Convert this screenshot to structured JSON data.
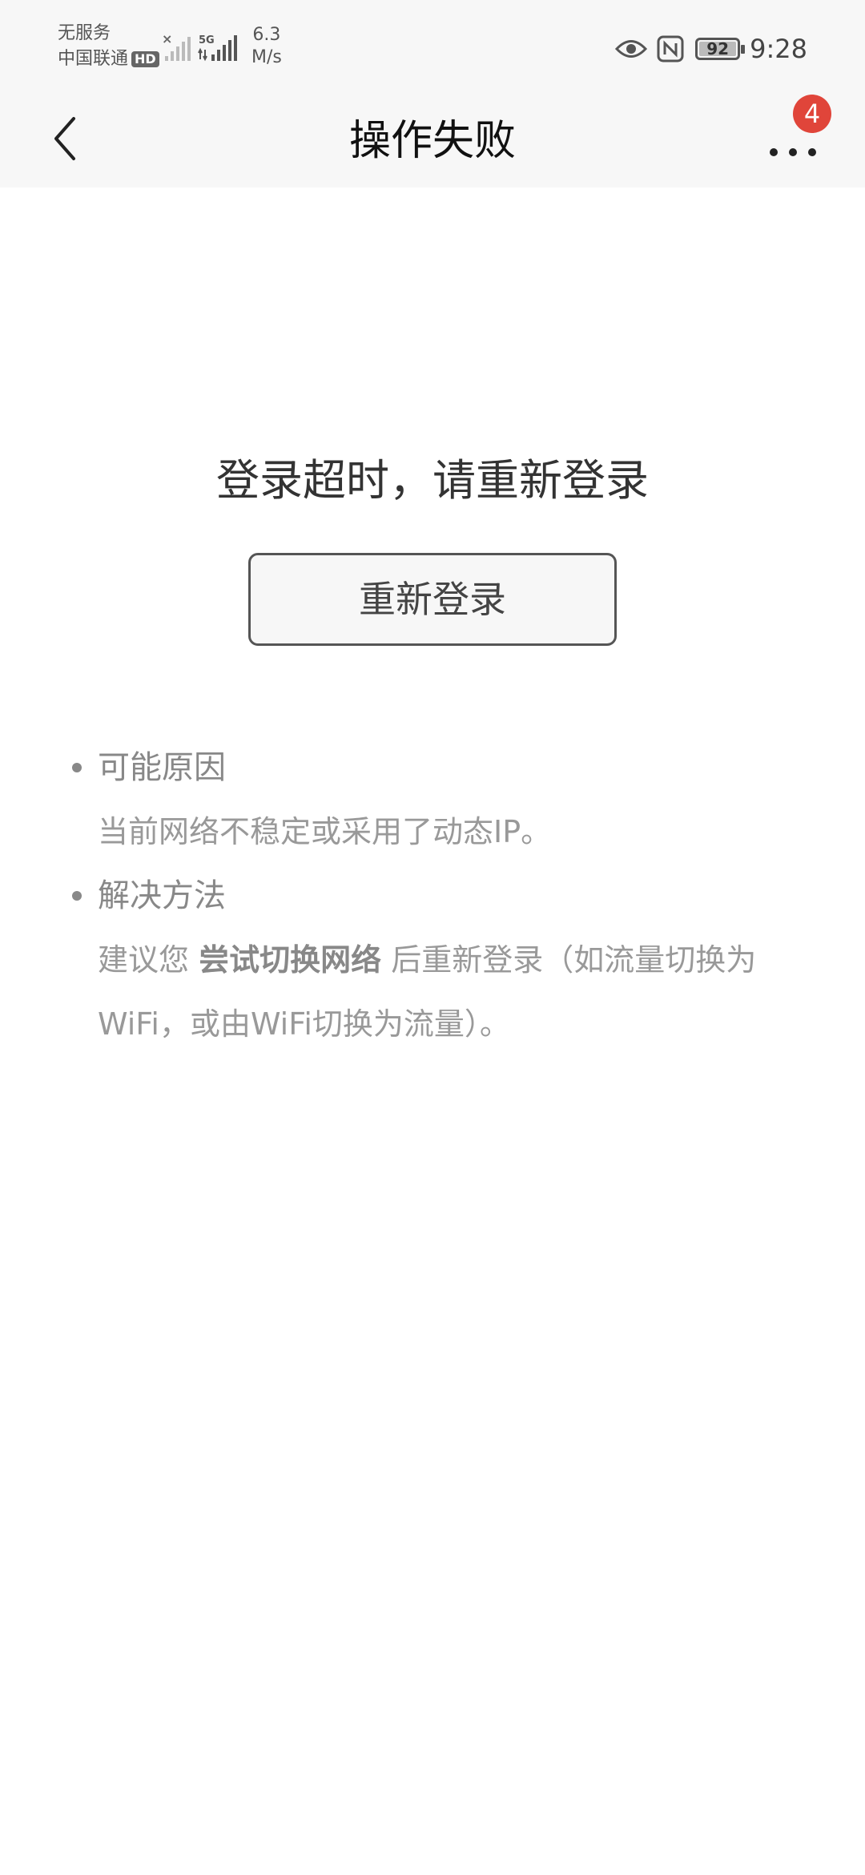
{
  "status": {
    "carrier_line1": "无服务",
    "carrier_line2": "中国联通",
    "hd_badge": "HD",
    "net_type": "5G",
    "speed_value": "6.3",
    "speed_unit": "M/s",
    "battery": "92",
    "time": "9:28"
  },
  "nav": {
    "title": "操作失败",
    "badge_count": "4"
  },
  "main": {
    "message": "登录超时，请重新登录",
    "button_label": "重新登录"
  },
  "tips": {
    "reason_title": "可能原因",
    "reason_text": "当前网络不稳定或采用了动态IP。",
    "solution_title": "解决方法",
    "solution_prefix": "建议您 ",
    "solution_bold": "尝试切换网络",
    "solution_suffix": " 后重新登录（如流量切换为WiFi，或由WiFi切换为流量）。"
  }
}
